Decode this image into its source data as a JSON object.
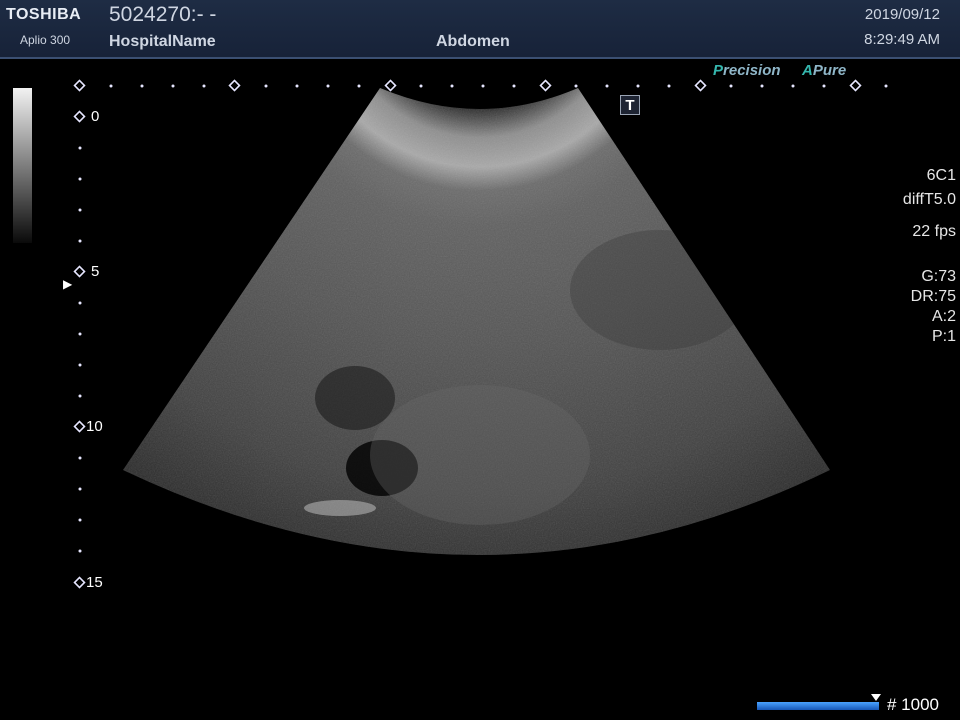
{
  "header": {
    "brand": "TOSHIBA",
    "model": "Aplio 300",
    "patient_id": "5024270:- -",
    "hospital": "HospitalName",
    "exam": "Abdomen",
    "date": "2019/09/12",
    "time": "8:29:49 AM"
  },
  "badges": {
    "precision_first": "P",
    "precision_rest": "recision",
    "apure_first": "A",
    "apure_rest": "Pure"
  },
  "t_icon": "T",
  "depth_labels": [
    "0",
    "5",
    "10",
    "15"
  ],
  "probe": {
    "transducer": "6C1",
    "preset": "diffT5.0",
    "fps": "22 fps",
    "gain": "G:73",
    "dynamic_range": "DR:75",
    "a": "A:2",
    "p": "P:1"
  },
  "focus_marker": "▶",
  "frame": {
    "label": "# 1000"
  }
}
